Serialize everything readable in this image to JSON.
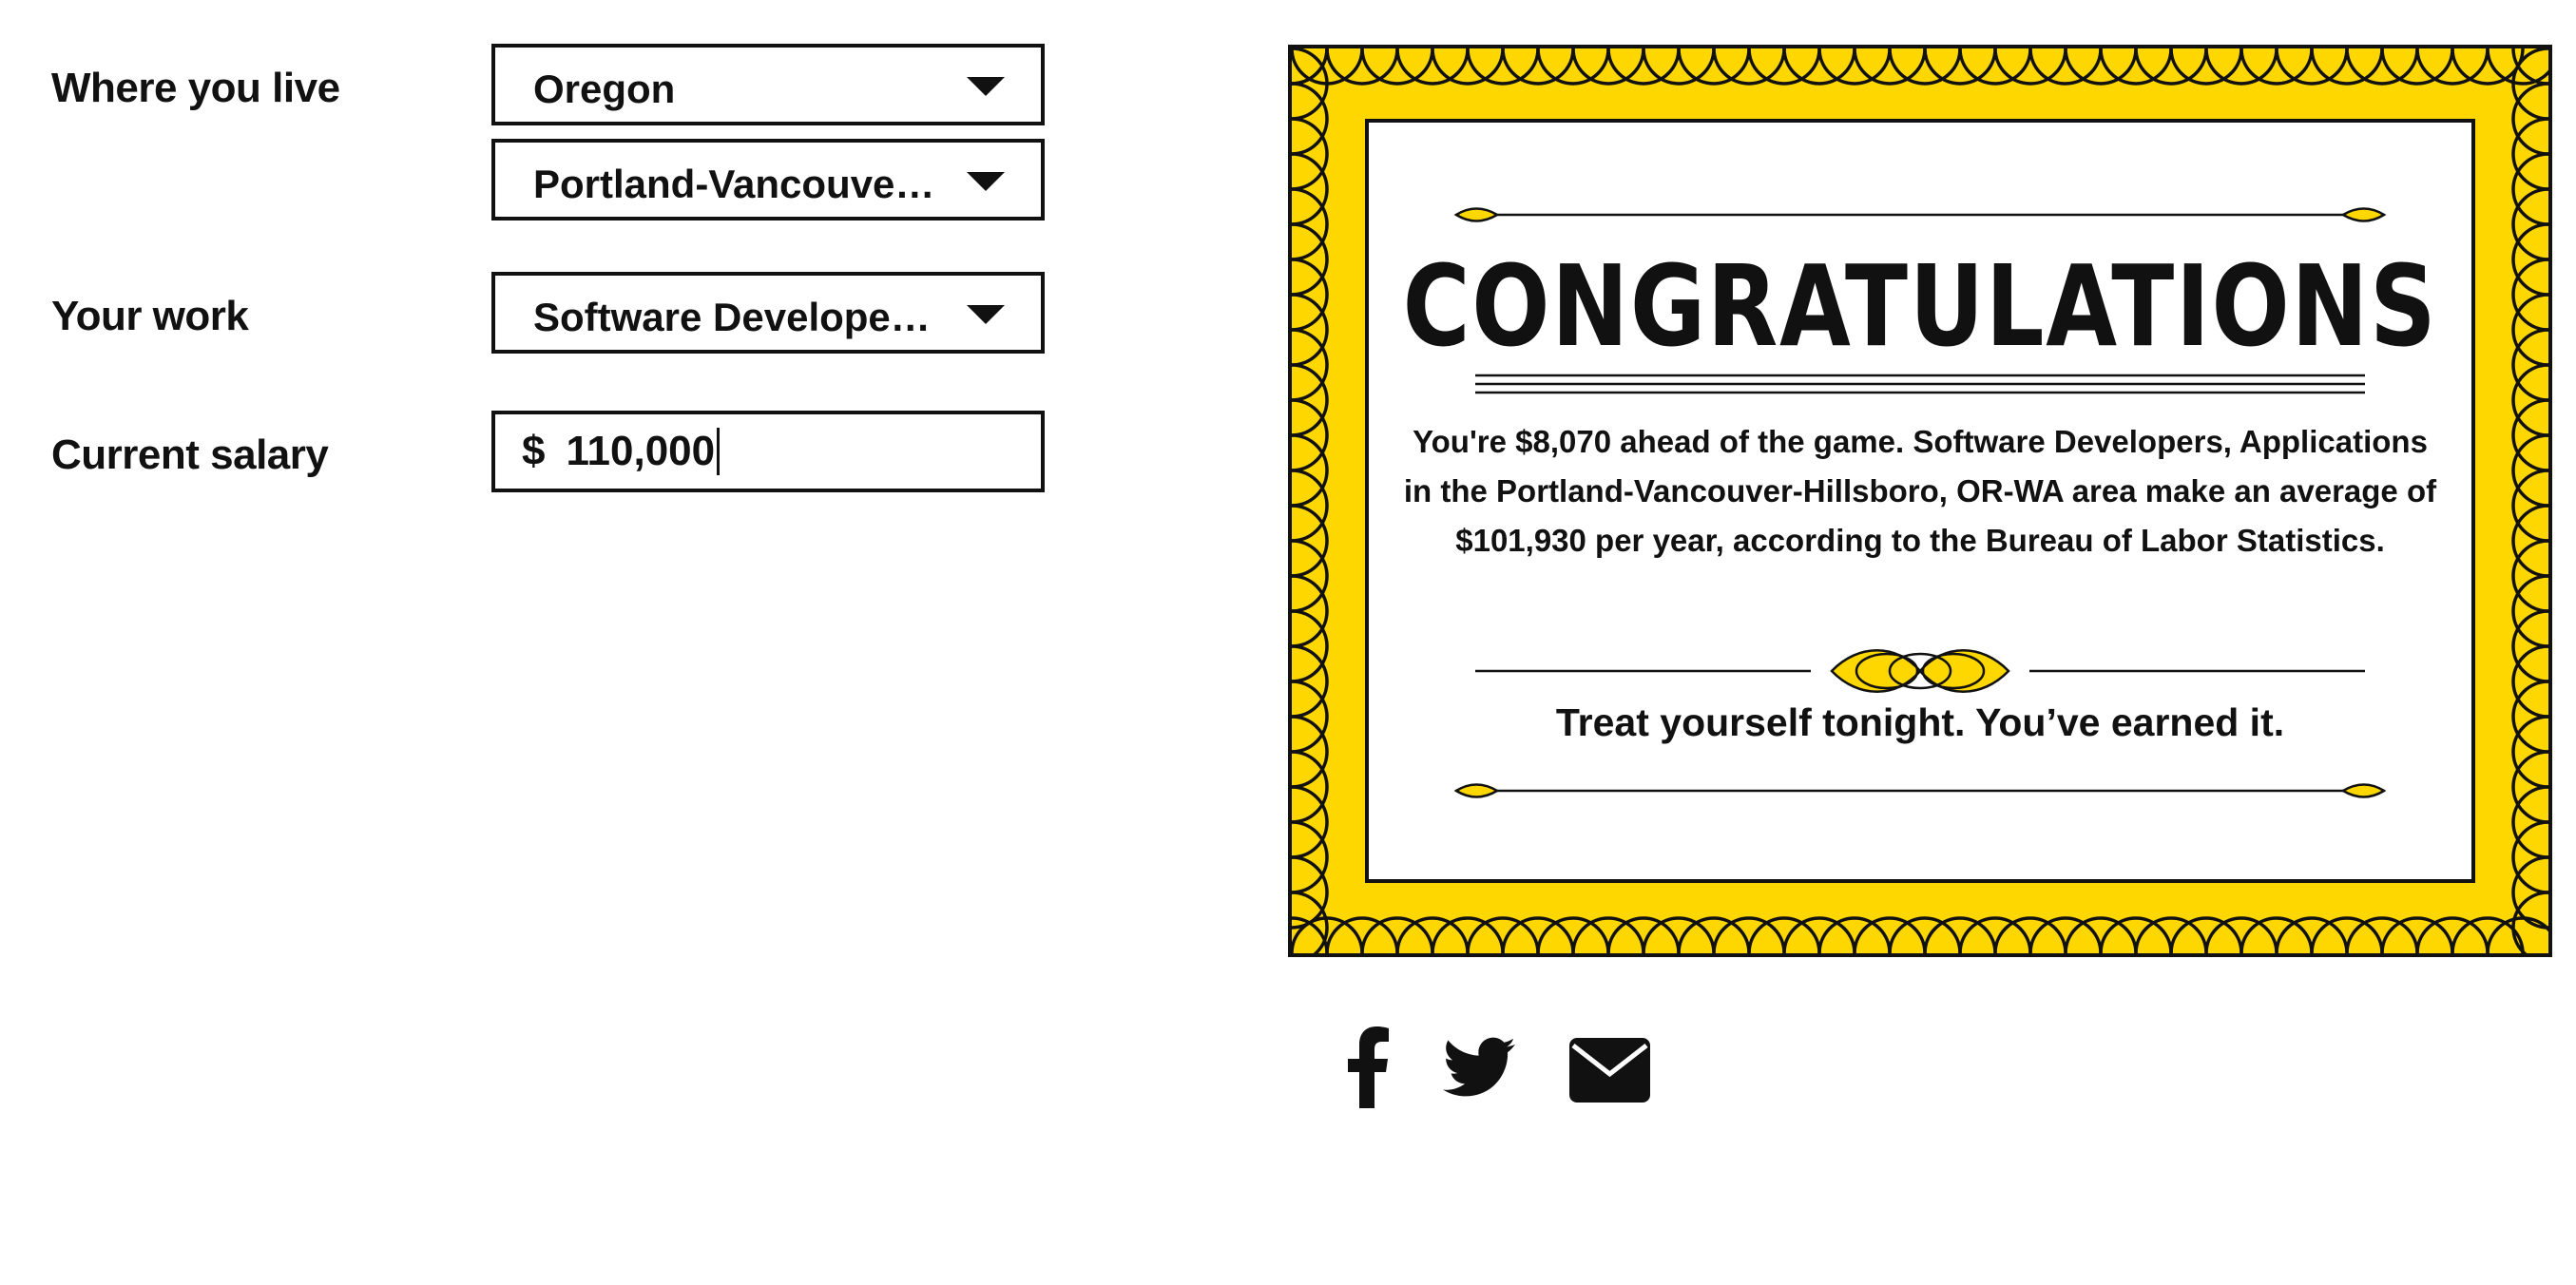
{
  "form": {
    "location_label": "Where you live",
    "state_value": "Oregon",
    "metro_value": "Portland-Vancouver-Hillsboro, OR-WA",
    "work_label": "Your work",
    "occupation_value": "Software Developers, Applications",
    "salary_label": "Current salary",
    "salary_currency": "$",
    "salary_value": "110,000"
  },
  "certificate": {
    "title": "CONGRATULATIONS",
    "body": "You're $8,070 ahead of the game. Software Developers, Applications in the Portland-Vancouver-Hillsboro, OR-WA area make an average of $101,930 per year, according to the Bureau of Labor Statistics.",
    "footer": "Treat yourself tonight. You’ve earned it.",
    "border_color": "#FFD700",
    "ink_color": "#111111"
  },
  "share": {
    "icons": [
      "facebook-icon",
      "twitter-icon",
      "email-icon"
    ]
  }
}
